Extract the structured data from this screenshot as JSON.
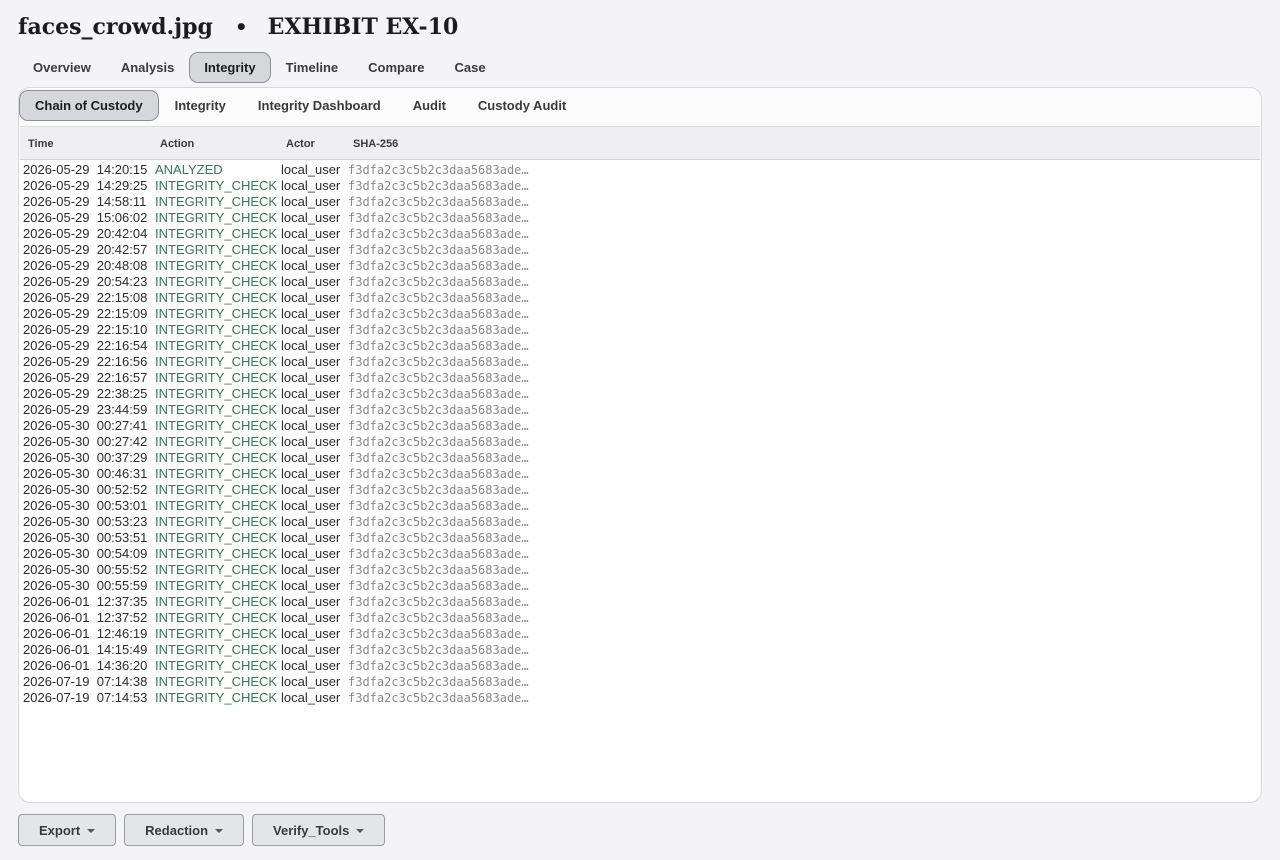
{
  "header": {
    "filename": "faces_crowd.jpg",
    "separator": "•",
    "exhibit": "EXHIBIT EX-10"
  },
  "main_tabs": [
    {
      "label": "Overview",
      "active": false
    },
    {
      "label": "Analysis",
      "active": false
    },
    {
      "label": "Integrity",
      "active": true
    },
    {
      "label": "Timeline",
      "active": false
    },
    {
      "label": "Compare",
      "active": false
    },
    {
      "label": "Case",
      "active": false
    }
  ],
  "sub_tabs": [
    {
      "label": "Chain of Custody",
      "active": true
    },
    {
      "label": "Integrity",
      "active": false
    },
    {
      "label": "Integrity Dashboard",
      "active": false
    },
    {
      "label": "Audit",
      "active": false
    },
    {
      "label": "Custody Audit",
      "active": false
    }
  ],
  "table": {
    "columns": [
      "Time",
      "Action",
      "Actor",
      "SHA-256"
    ],
    "rows": [
      [
        "2026-05-29  14:20:15",
        "ANALYZED",
        "local_user",
        "f3dfa2c3c5b2c3daa5683ade…"
      ],
      [
        "2026-05-29  14:29:25",
        "INTEGRITY_CHECK",
        "local_user",
        "f3dfa2c3c5b2c3daa5683ade…"
      ],
      [
        "2026-05-29  14:58:11",
        "INTEGRITY_CHECK",
        "local_user",
        "f3dfa2c3c5b2c3daa5683ade…"
      ],
      [
        "2026-05-29  15:06:02",
        "INTEGRITY_CHECK",
        "local_user",
        "f3dfa2c3c5b2c3daa5683ade…"
      ],
      [
        "2026-05-29  20:42:04",
        "INTEGRITY_CHECK",
        "local_user",
        "f3dfa2c3c5b2c3daa5683ade…"
      ],
      [
        "2026-05-29  20:42:57",
        "INTEGRITY_CHECK",
        "local_user",
        "f3dfa2c3c5b2c3daa5683ade…"
      ],
      [
        "2026-05-29  20:48:08",
        "INTEGRITY_CHECK",
        "local_user",
        "f3dfa2c3c5b2c3daa5683ade…"
      ],
      [
        "2026-05-29  20:54:23",
        "INTEGRITY_CHECK",
        "local_user",
        "f3dfa2c3c5b2c3daa5683ade…"
      ],
      [
        "2026-05-29  22:15:08",
        "INTEGRITY_CHECK",
        "local_user",
        "f3dfa2c3c5b2c3daa5683ade…"
      ],
      [
        "2026-05-29  22:15:09",
        "INTEGRITY_CHECK",
        "local_user",
        "f3dfa2c3c5b2c3daa5683ade…"
      ],
      [
        "2026-05-29  22:15:10",
        "INTEGRITY_CHECK",
        "local_user",
        "f3dfa2c3c5b2c3daa5683ade…"
      ],
      [
        "2026-05-29  22:16:54",
        "INTEGRITY_CHECK",
        "local_user",
        "f3dfa2c3c5b2c3daa5683ade…"
      ],
      [
        "2026-05-29  22:16:56",
        "INTEGRITY_CHECK",
        "local_user",
        "f3dfa2c3c5b2c3daa5683ade…"
      ],
      [
        "2026-05-29  22:16:57",
        "INTEGRITY_CHECK",
        "local_user",
        "f3dfa2c3c5b2c3daa5683ade…"
      ],
      [
        "2026-05-29  22:38:25",
        "INTEGRITY_CHECK",
        "local_user",
        "f3dfa2c3c5b2c3daa5683ade…"
      ],
      [
        "2026-05-29  23:44:59",
        "INTEGRITY_CHECK",
        "local_user",
        "f3dfa2c3c5b2c3daa5683ade…"
      ],
      [
        "2026-05-30  00:27:41",
        "INTEGRITY_CHECK",
        "local_user",
        "f3dfa2c3c5b2c3daa5683ade…"
      ],
      [
        "2026-05-30  00:27:42",
        "INTEGRITY_CHECK",
        "local_user",
        "f3dfa2c3c5b2c3daa5683ade…"
      ],
      [
        "2026-05-30  00:37:29",
        "INTEGRITY_CHECK",
        "local_user",
        "f3dfa2c3c5b2c3daa5683ade…"
      ],
      [
        "2026-05-30  00:46:31",
        "INTEGRITY_CHECK",
        "local_user",
        "f3dfa2c3c5b2c3daa5683ade…"
      ],
      [
        "2026-05-30  00:52:52",
        "INTEGRITY_CHECK",
        "local_user",
        "f3dfa2c3c5b2c3daa5683ade…"
      ],
      [
        "2026-05-30  00:53:01",
        "INTEGRITY_CHECK",
        "local_user",
        "f3dfa2c3c5b2c3daa5683ade…"
      ],
      [
        "2026-05-30  00:53:23",
        "INTEGRITY_CHECK",
        "local_user",
        "f3dfa2c3c5b2c3daa5683ade…"
      ],
      [
        "2026-05-30  00:53:51",
        "INTEGRITY_CHECK",
        "local_user",
        "f3dfa2c3c5b2c3daa5683ade…"
      ],
      [
        "2026-05-30  00:54:09",
        "INTEGRITY_CHECK",
        "local_user",
        "f3dfa2c3c5b2c3daa5683ade…"
      ],
      [
        "2026-05-30  00:55:52",
        "INTEGRITY_CHECK",
        "local_user",
        "f3dfa2c3c5b2c3daa5683ade…"
      ],
      [
        "2026-05-30  00:55:59",
        "INTEGRITY_CHECK",
        "local_user",
        "f3dfa2c3c5b2c3daa5683ade…"
      ],
      [
        "2026-06-01  12:37:35",
        "INTEGRITY_CHECK",
        "local_user",
        "f3dfa2c3c5b2c3daa5683ade…"
      ],
      [
        "2026-06-01  12:37:52",
        "INTEGRITY_CHECK",
        "local_user",
        "f3dfa2c3c5b2c3daa5683ade…"
      ],
      [
        "2026-06-01  12:46:19",
        "INTEGRITY_CHECK",
        "local_user",
        "f3dfa2c3c5b2c3daa5683ade…"
      ],
      [
        "2026-06-01  14:15:49",
        "INTEGRITY_CHECK",
        "local_user",
        "f3dfa2c3c5b2c3daa5683ade…"
      ],
      [
        "2026-06-01  14:36:20",
        "INTEGRITY_CHECK",
        "local_user",
        "f3dfa2c3c5b2c3daa5683ade…"
      ],
      [
        "2026-07-19  07:14:38",
        "INTEGRITY_CHECK",
        "local_user",
        "f3dfa2c3c5b2c3daa5683ade…"
      ],
      [
        "2026-07-19  07:14:53",
        "INTEGRITY_CHECK",
        "local_user",
        "f3dfa2c3c5b2c3daa5683ade…"
      ]
    ]
  },
  "bottom_buttons": [
    {
      "label": "Export",
      "icon": "chevron-down-icon"
    },
    {
      "label": "Redaction",
      "icon": "chevron-down-icon"
    },
    {
      "label": "Verify_Tools",
      "icon": "chevron-down-icon"
    }
  ],
  "colors": {
    "action_text": "#2f7a57",
    "active_tab_bg": "#d6d7db",
    "page_bg": "#f4f4f6"
  }
}
